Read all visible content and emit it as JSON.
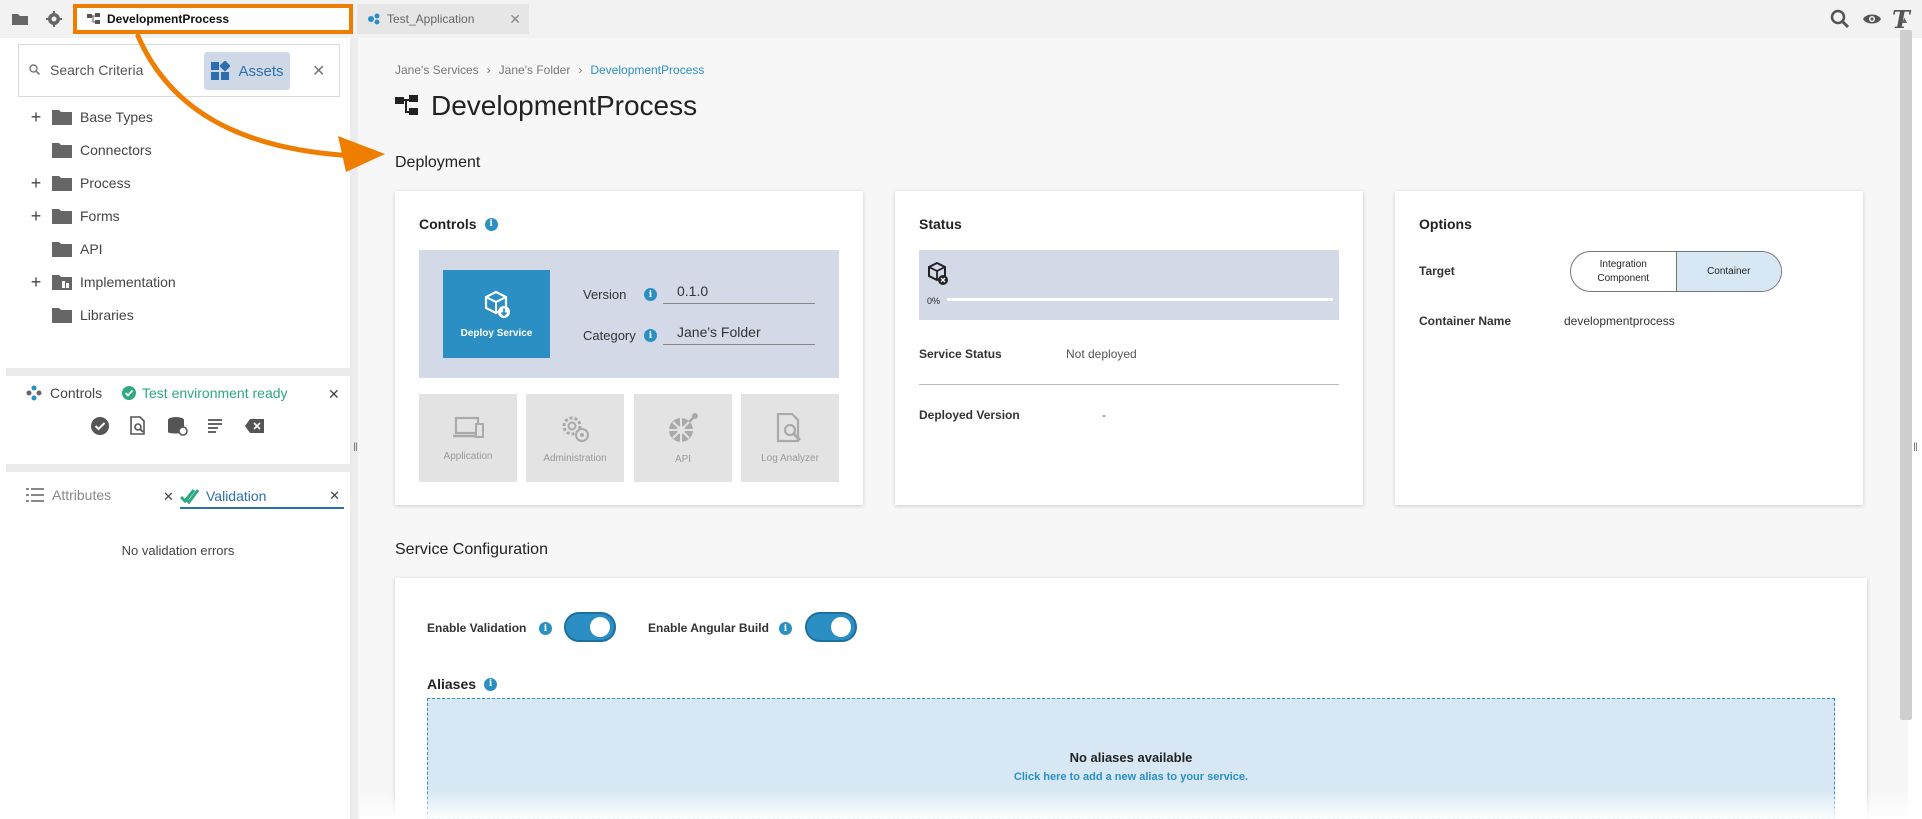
{
  "tabs": [
    {
      "label": "DevelopmentProcess",
      "active": true
    },
    {
      "label": "Test_Application",
      "active": false
    }
  ],
  "toolbar": {
    "icons": [
      "folder-icon",
      "gear-icon",
      "search-icon",
      "eye-icon",
      "t-icon"
    ]
  },
  "search": {
    "placeholder": "Search Criteria",
    "assets_label": "Assets"
  },
  "tree": [
    {
      "label": "Base Types",
      "expandable": true
    },
    {
      "label": "Connectors",
      "expandable": false
    },
    {
      "label": "Process",
      "expandable": true
    },
    {
      "label": "Forms",
      "expandable": true
    },
    {
      "label": "API",
      "expandable": false
    },
    {
      "label": "Implementation",
      "expandable": true
    },
    {
      "label": "Libraries",
      "expandable": false
    }
  ],
  "controls_panel": {
    "title": "Controls",
    "status": "Test environment ready"
  },
  "bottom_panel": {
    "attributes_tab": "Attributes",
    "validation_tab": "Validation",
    "empty_text": "No validation errors"
  },
  "breadcrumb": [
    "Jane's Services",
    "Jane's Folder",
    "DevelopmentProcess"
  ],
  "page_title": "DevelopmentProcess",
  "deployment": {
    "heading": "Deployment",
    "controls": {
      "title": "Controls",
      "deploy_label": "Deploy Service",
      "version_label": "Version",
      "version_value": "0.1.0",
      "category_label": "Category",
      "category_value": "Jane's Folder",
      "tools": [
        "Application",
        "Administration",
        "API",
        "Log Analyzer"
      ]
    },
    "status": {
      "title": "Status",
      "progress_label": "0%",
      "progress": 0,
      "service_status_label": "Service Status",
      "service_status_value": "Not deployed",
      "deployed_version_label": "Deployed Version",
      "deployed_version_value": "-"
    },
    "options": {
      "title": "Options",
      "target_label": "Target",
      "target_option_1_line1": "Integration",
      "target_option_1_line2": "Component",
      "target_option_2": "Container",
      "selected_target": "Container",
      "container_name_label": "Container Name",
      "container_name_value": "developmentprocess"
    }
  },
  "service_config": {
    "heading": "Service Configuration",
    "enable_validation_label": "Enable Validation",
    "enable_validation": true,
    "enable_angular_label": "Enable Angular Build",
    "enable_angular": true,
    "aliases_title": "Aliases",
    "aliases_empty": "No aliases available",
    "aliases_hint": "Click here to add a new alias to your service."
  },
  "colors": {
    "accent": "#2b8fc4",
    "highlight": "#ef7d00",
    "success": "#2ea87f"
  }
}
